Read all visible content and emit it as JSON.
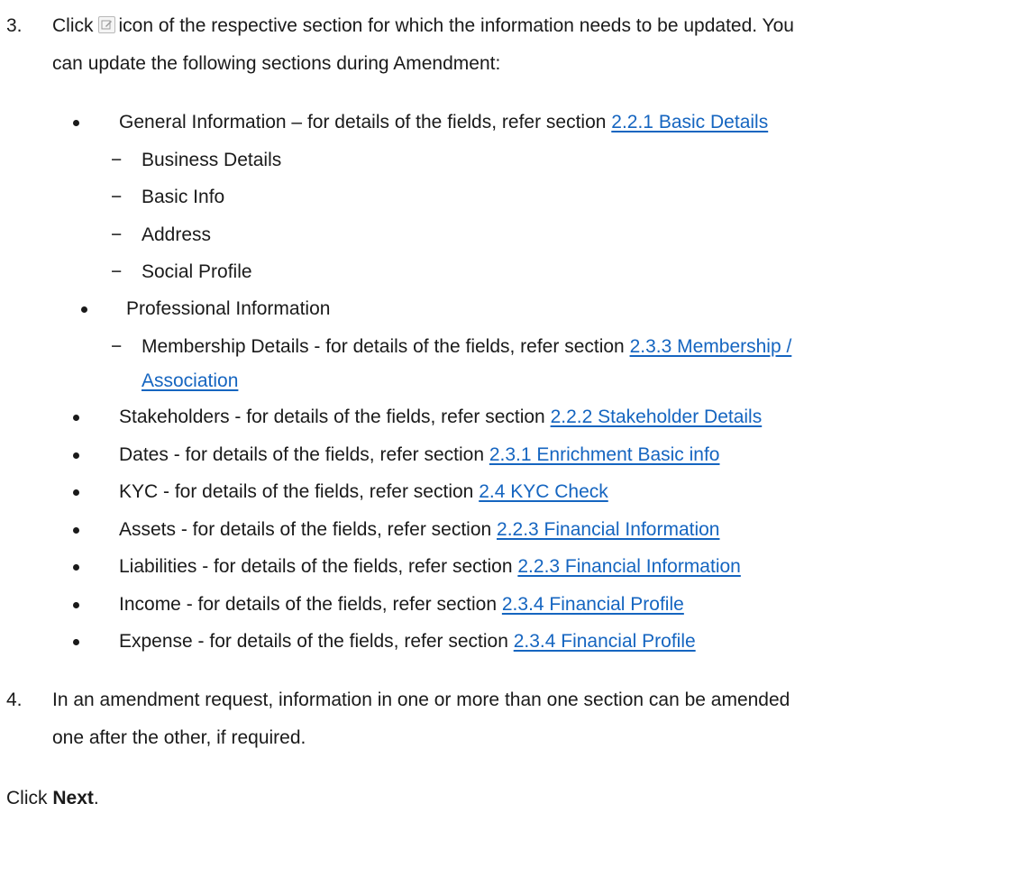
{
  "step3": {
    "number": "3.",
    "prefix": "Click",
    "icon": "edit-icon",
    "suffix": "icon of the respective section for which the information needs to be updated. You",
    "line2": "can update the following sections during Amendment:"
  },
  "sections": [
    {
      "text": "General Information – for details of the fields, refer section ",
      "link": "2.2.1 Basic Details",
      "subitems": [
        "Business Details",
        "Basic Info",
        "Address",
        "Social Profile"
      ]
    },
    {
      "text": "Professional Information",
      "subitems": [
        {
          "text": "Membership Details - for details of the fields, refer section ",
          "link_line1": "2.3.3 Membership /",
          "link_line2": "Association"
        }
      ]
    },
    {
      "text": "Stakeholders - for details of the fields, refer section ",
      "link": "2.2.2 Stakeholder Details"
    },
    {
      "text": "Dates - for details of the fields, refer section ",
      "link": "2.3.1 Enrichment Basic info"
    },
    {
      "text": "KYC - for details of the fields, refer section ",
      "link": "2.4 KYC Check"
    },
    {
      "text": "Assets - for details of the fields, refer section ",
      "link": "2.2.3 Financial Information"
    },
    {
      "text": "Liabilities - for details of the fields, refer section ",
      "link": "2.2.3 Financial Information"
    },
    {
      "text": "Income - for details of the fields, refer section ",
      "link": "2.3.4 Financial Profile"
    },
    {
      "text": "Expense - for details of the fields, refer section ",
      "link": "2.3.4 Financial Profile"
    }
  ],
  "step4": {
    "number": "4.",
    "line1": "In an amendment request, information in one or more than one section can be amended",
    "line2": "one after the other, if required."
  },
  "final": {
    "prefix": "Click ",
    "bold": "Next",
    "suffix": "."
  },
  "colors": {
    "link": "#1565c0",
    "text": "#1a1a1a"
  }
}
